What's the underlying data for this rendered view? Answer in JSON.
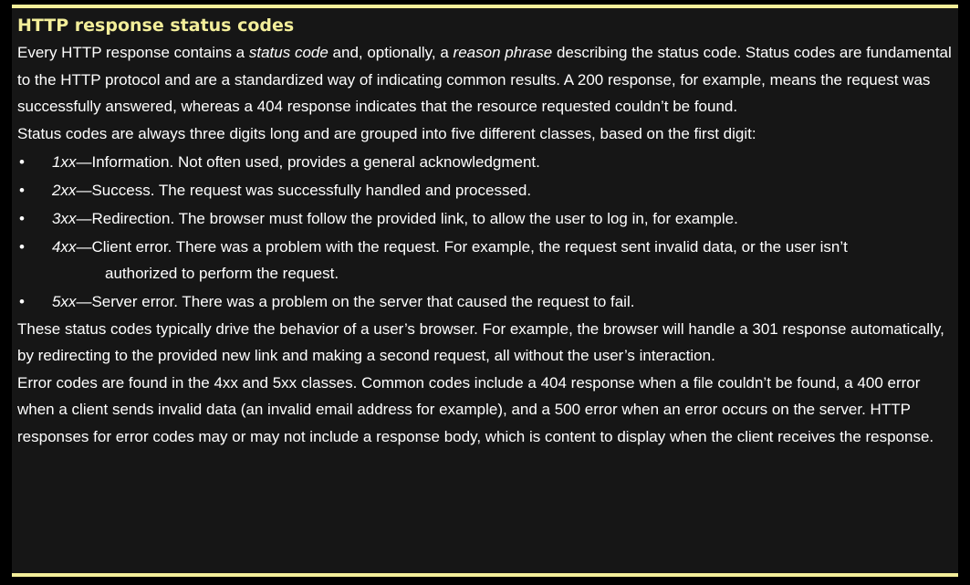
{
  "article": {
    "title": "HTTP response status codes",
    "intro": {
      "p1_a": "Every HTTP response contains a ",
      "p1_b": "status code",
      "p1_c": " and, optionally, a ",
      "p1_d": "reason phrase",
      "p1_e": " describing the status code. Status codes are fundamental to the HTTP protocol and are a standardized way of indicating common results. A 200 response, for example, means the request was successfully answered, whereas a 404 response indicates that the resource requested couldn’t be found.",
      "p2": "Status codes are always three digits long and are grouped into five different classes, based on the first digit:"
    },
    "classes": [
      {
        "code": "1xx",
        "text": "—Information. Not often used, provides a general acknowledgment.",
        "cont": ""
      },
      {
        "code": "2xx",
        "text": "—Success. The request was successfully handled and processed.",
        "cont": ""
      },
      {
        "code": "3xx",
        "text": "—Redirection. The browser must follow the provided link, to allow the user to log in, for example.",
        "cont": ""
      },
      {
        "code": "4xx",
        "text": "—Client error. There was a problem with the request. For example, the request sent invalid data, or the user isn’t",
        "cont": "authorized to perform the request."
      },
      {
        "code": "5xx",
        "text": "—Server error. There was a problem on the server that caused the request to fail.",
        "cont": ""
      }
    ],
    "bullet_glyph": "•",
    "p3": "These status codes typically drive the behavior of a user’s browser. For example, the browser will handle a 301 response automatically, by redirecting to the provided new link and making a second request, all without the user’s interaction.",
    "p4": "Error codes are found in the 4xx and 5xx classes. Common codes include a 404 response when a file couldn’t be found, a 400 error when a client sends invalid data (an invalid email address for example), and a 500 error when an error occurs on the server. HTTP responses for error codes may or may not include a response body, which is content to display when the client receives the response."
  },
  "colors": {
    "background": "#000000",
    "panel": "#161616",
    "accent": "#f3ee9a",
    "text": "#ffffff"
  }
}
